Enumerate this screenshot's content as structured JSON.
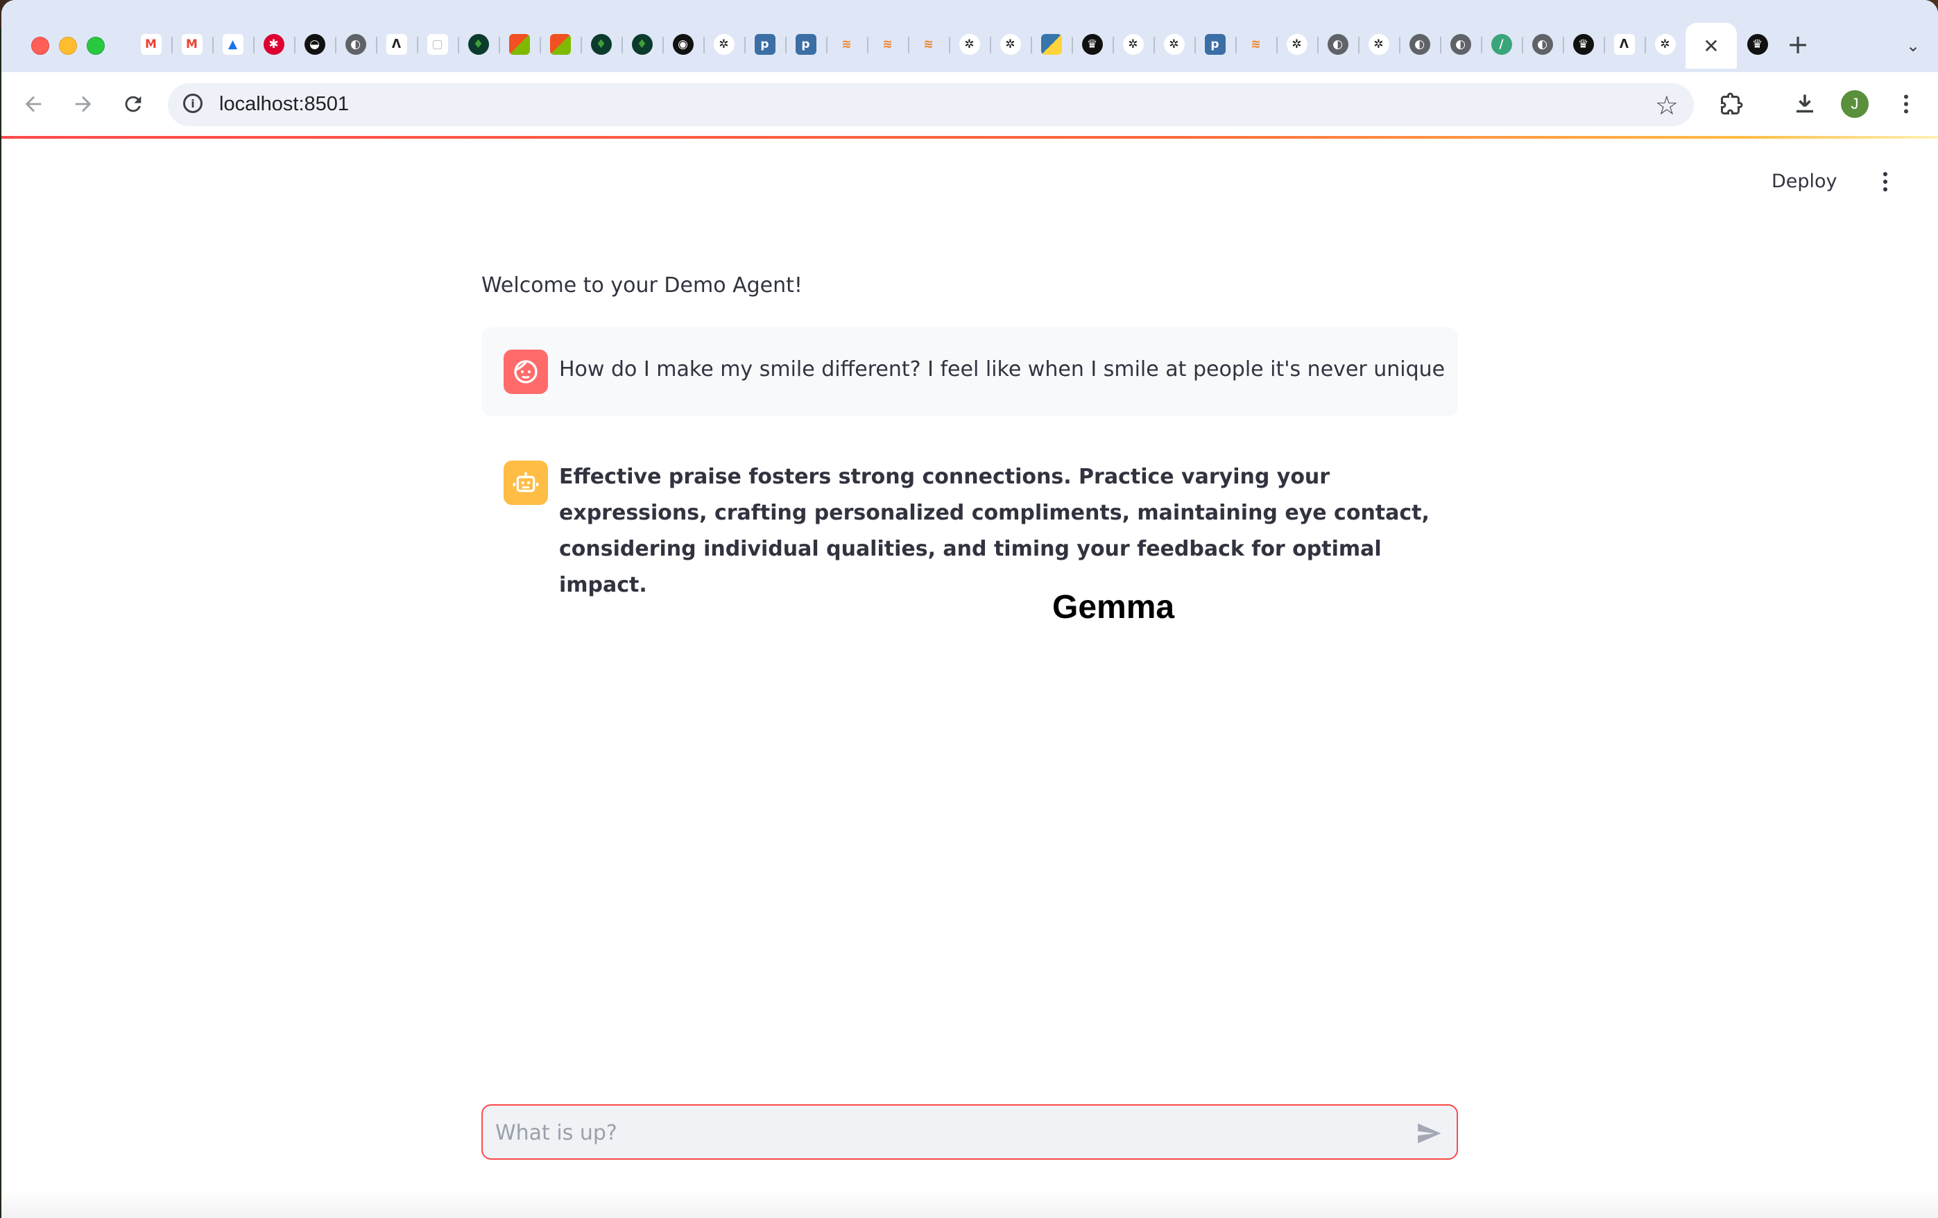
{
  "browser": {
    "tab_favicons": [
      "gmail-icon",
      "gmail-icon",
      "google-drive-icon",
      "angular-icon",
      "kuma-icon",
      "globe-icon",
      "llama-icon",
      "cube-icon",
      "mongodb-icon",
      "microsoft-icon",
      "microsoft-icon",
      "mongodb-icon",
      "mongodb-icon",
      "github-icon",
      "openai-icon",
      "p-icon",
      "p-icon",
      "stackoverflow-icon",
      "stackoverflow-icon",
      "stackoverflow-icon",
      "openai-icon",
      "openai-icon",
      "python-icon",
      "crown-icon",
      "openai-icon",
      "openai-icon",
      "p-icon",
      "stackoverflow-icon",
      "openai-icon",
      "globe-icon",
      "openai-icon",
      "globe-icon",
      "globe-icon",
      "flask-icon",
      "globe-icon",
      "crown-icon",
      "llama-icon",
      "openai-icon",
      "crown-icon"
    ],
    "active_tab_close": "✕",
    "new_tab": "+",
    "url": "localhost:8501",
    "profile_initial": "J",
    "colors": {
      "accent": "#ff4b4b",
      "tabstrip": "#dfe7f6"
    }
  },
  "app": {
    "deploy_label": "Deploy",
    "welcome": "Welcome to your Demo Agent!",
    "messages": [
      {
        "role": "user",
        "avatar_icon": "smiley-face-icon",
        "text": "How do I make my smile different? I feel like when I smile at people it's never unique"
      },
      {
        "role": "assistant",
        "avatar_icon": "robot-icon",
        "text": "Effective praise fosters strong connections. Practice varying your expressions, crafting personalized compliments, maintaining eye contact, considering individual qualities, and timing your feedback for optimal impact."
      }
    ],
    "heading": "Gemma",
    "input_placeholder": "What is up?"
  }
}
